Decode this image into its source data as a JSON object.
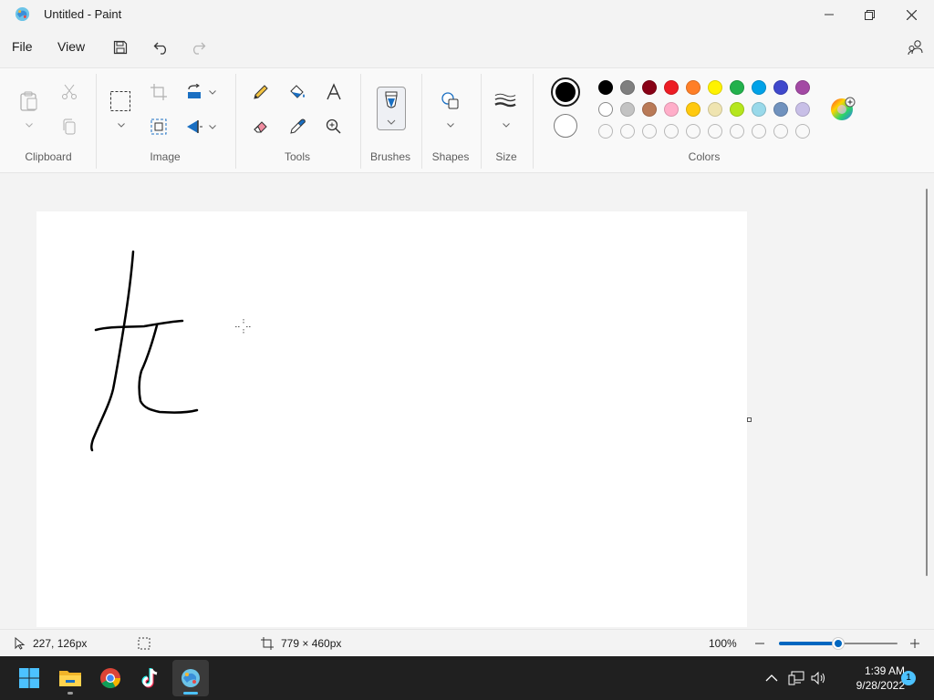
{
  "window": {
    "title": "Untitled - Paint"
  },
  "menu": {
    "file": "File",
    "view": "View"
  },
  "ribbon": {
    "groups": {
      "clipboard": "Clipboard",
      "image": "Image",
      "tools": "Tools",
      "brushes": "Brushes",
      "shapes": "Shapes",
      "size": "Size",
      "colors": "Colors"
    },
    "primary_color": "#000000",
    "secondary_color": "#ffffff",
    "palette_row1": [
      "#000000",
      "#7f7f7f",
      "#880015",
      "#ed1c24",
      "#ff7f27",
      "#fff200",
      "#22b14c",
      "#00a2e8",
      "#3f48cc",
      "#a349a4"
    ],
    "palette_row2": [
      "#ffffff",
      "#c3c3c3",
      "#b97a57",
      "#ffaec9",
      "#ffc90e",
      "#efe4b0",
      "#b5e61d",
      "#99d9ea",
      "#7092be",
      "#c8bfe7"
    ]
  },
  "status": {
    "cursor_position": "227, 126px",
    "canvas_size": "779 × 460px",
    "zoom": "100%",
    "zoom_level": 0.5
  },
  "taskbar": {
    "time": "1:39 AM",
    "date": "9/28/2022",
    "notification_count": "1",
    "apps": [
      "start-icon",
      "file-explorer-icon",
      "chrome-icon",
      "tiktok-icon",
      "paint-icon"
    ]
  }
}
